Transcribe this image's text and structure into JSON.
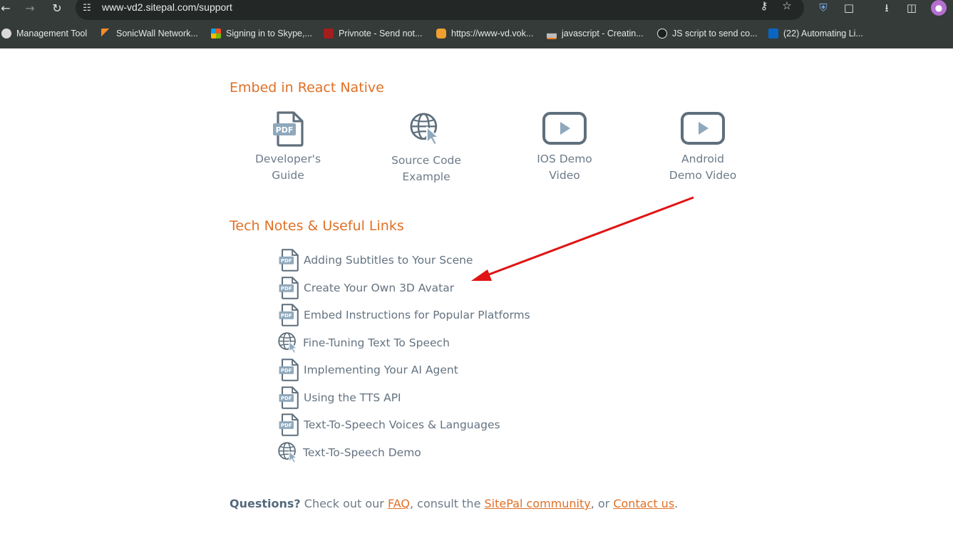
{
  "browser": {
    "url": "www-vd2.sitepal.com/support",
    "bookmarks": [
      {
        "label": "Management Tool",
        "icon": "globe-icon"
      },
      {
        "label": "SonicWall Network...",
        "icon": "sonicwall-icon"
      },
      {
        "label": "Signing in to Skype,...",
        "icon": "microsoft-icon"
      },
      {
        "label": "Privnote - Send not...",
        "icon": "privnote-icon"
      },
      {
        "label": "https://www-vd.vok...",
        "icon": "chat-icon"
      },
      {
        "label": "javascript - Creatin...",
        "icon": "stackoverflow-icon"
      },
      {
        "label": "JS script to send co...",
        "icon": "github-icon"
      },
      {
        "label": "(22) Automating Li...",
        "icon": "linkedin-icon"
      }
    ]
  },
  "embed_section": {
    "title": "Embed in React Native",
    "items": [
      {
        "line1": "Developer's",
        "line2": "Guide",
        "icon": "pdf-icon"
      },
      {
        "line1": "Source Code",
        "line2": "Example",
        "icon": "globe-cursor-icon"
      },
      {
        "line1": "IOS Demo",
        "line2": "Video",
        "icon": "video-play-icon"
      },
      {
        "line1": "Android",
        "line2": "Demo Video",
        "icon": "video-play-icon"
      }
    ]
  },
  "tech_section": {
    "title": "Tech Notes & Useful Links",
    "links": [
      {
        "label": "Adding Subtitles to Your Scene",
        "icon": "pdf-icon"
      },
      {
        "label": "Create Your Own 3D Avatar",
        "icon": "pdf-icon"
      },
      {
        "label": "Embed Instructions for Popular Platforms",
        "icon": "pdf-icon"
      },
      {
        "label": "Fine-Tuning Text To Speech",
        "icon": "globe-cursor-icon"
      },
      {
        "label": "Implementing Your AI Agent",
        "icon": "pdf-icon"
      },
      {
        "label": "Using the TTS API",
        "icon": "pdf-icon"
      },
      {
        "label": "Text-To-Speech Voices & Languages",
        "icon": "pdf-icon"
      },
      {
        "label": "Text-To-Speech Demo",
        "icon": "globe-cursor-icon"
      }
    ]
  },
  "footer": {
    "questions": "Questions?",
    "text1": " Check out our ",
    "faq": "FAQ",
    "text2": ", consult the ",
    "community": "SitePal community",
    "text3": ", or ",
    "contact": "Contact us",
    "text4": "."
  },
  "colors": {
    "accent_orange": "#e07025",
    "text_slate": "#6c7b89",
    "icon_slate": "#5f6f7c",
    "annotation_arrow": "#e01414"
  }
}
